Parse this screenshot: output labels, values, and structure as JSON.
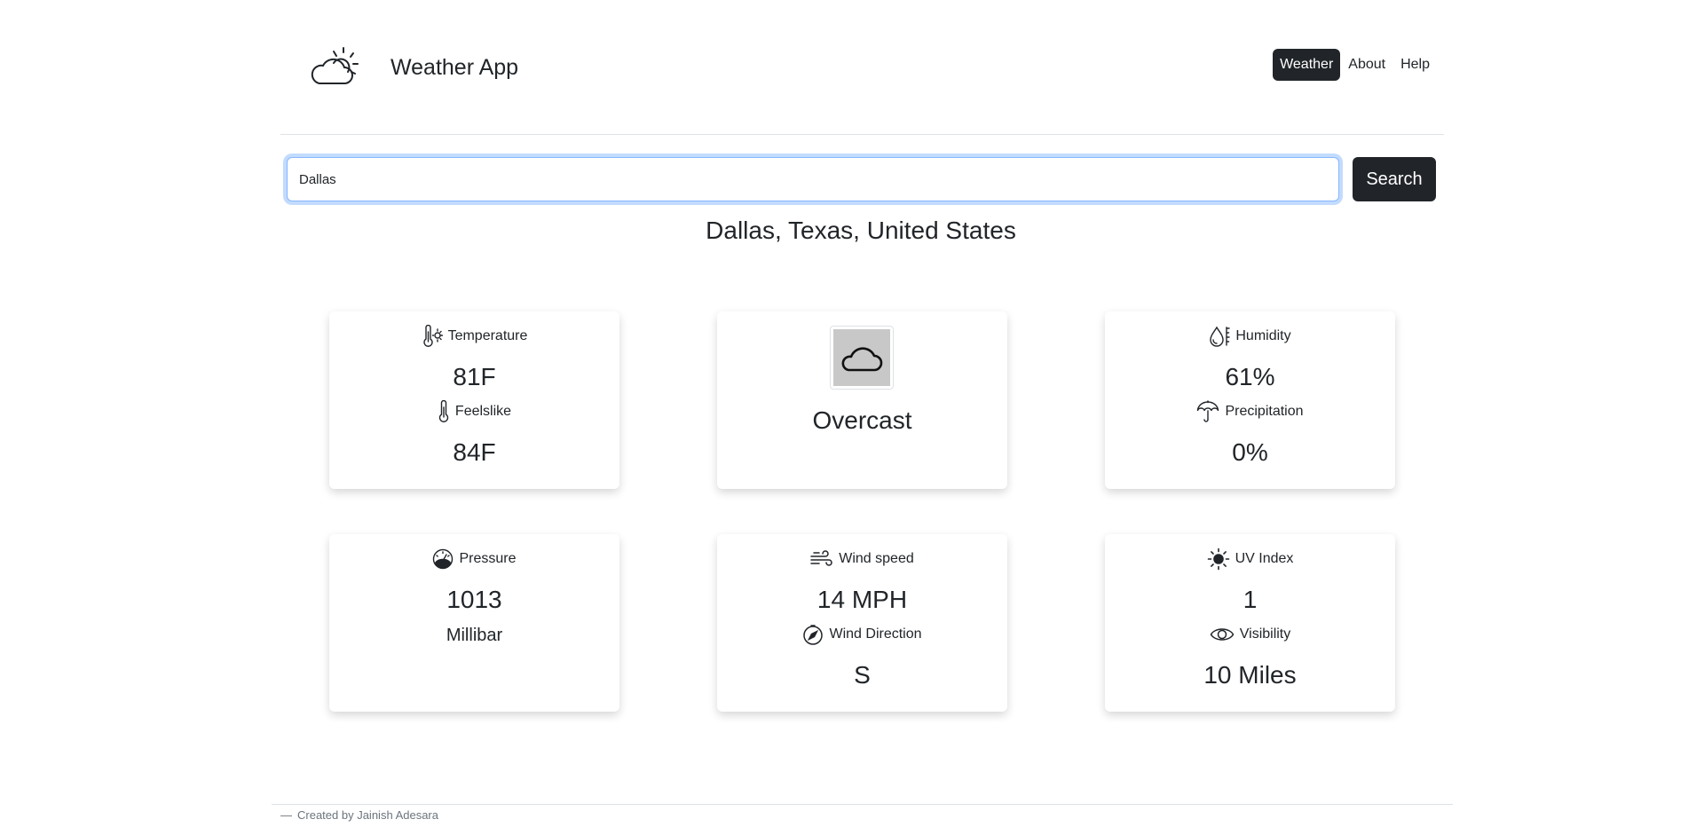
{
  "header": {
    "title": "Weather App",
    "nav": [
      {
        "label": "Weather",
        "active": true
      },
      {
        "label": "About",
        "active": false
      },
      {
        "label": "Help",
        "active": false
      }
    ]
  },
  "search": {
    "value": "Dallas",
    "button_label": "Search"
  },
  "location": "Dallas, Texas, United States",
  "cards": {
    "temperature": {
      "label": "Temperature",
      "value": "81F",
      "icon": "thermometer-sun-icon"
    },
    "feelslike": {
      "label": "Feelslike",
      "value": "84F",
      "icon": "thermometer-icon"
    },
    "condition": {
      "text": "Overcast",
      "icon": "cloud-icon"
    },
    "humidity": {
      "label": "Humidity",
      "value": "61%",
      "icon": "moisture-icon"
    },
    "precipitation": {
      "label": "Precipitation",
      "value": "0%",
      "icon": "umbrella-icon"
    },
    "pressure": {
      "label": "Pressure",
      "value": "1013",
      "unit": "Millibar",
      "icon": "speedometer-icon"
    },
    "wind_speed": {
      "label": "Wind speed",
      "value": "14 MPH",
      "icon": "wind-icon"
    },
    "wind_direction": {
      "label": "Wind Direction",
      "value": "S",
      "icon": "compass-icon"
    },
    "uv_index": {
      "label": "UV Index",
      "value": "1",
      "icon": "sun-icon"
    },
    "visibility": {
      "label": "Visibility",
      "value": "10 Miles",
      "icon": "eye-icon"
    }
  },
  "footer": {
    "dash": "—",
    "text": "Created by Jainish Adesara"
  },
  "colors": {
    "primary_dark": "#212529",
    "focus_border": "#86b7fe",
    "muted": "#6c757d"
  }
}
